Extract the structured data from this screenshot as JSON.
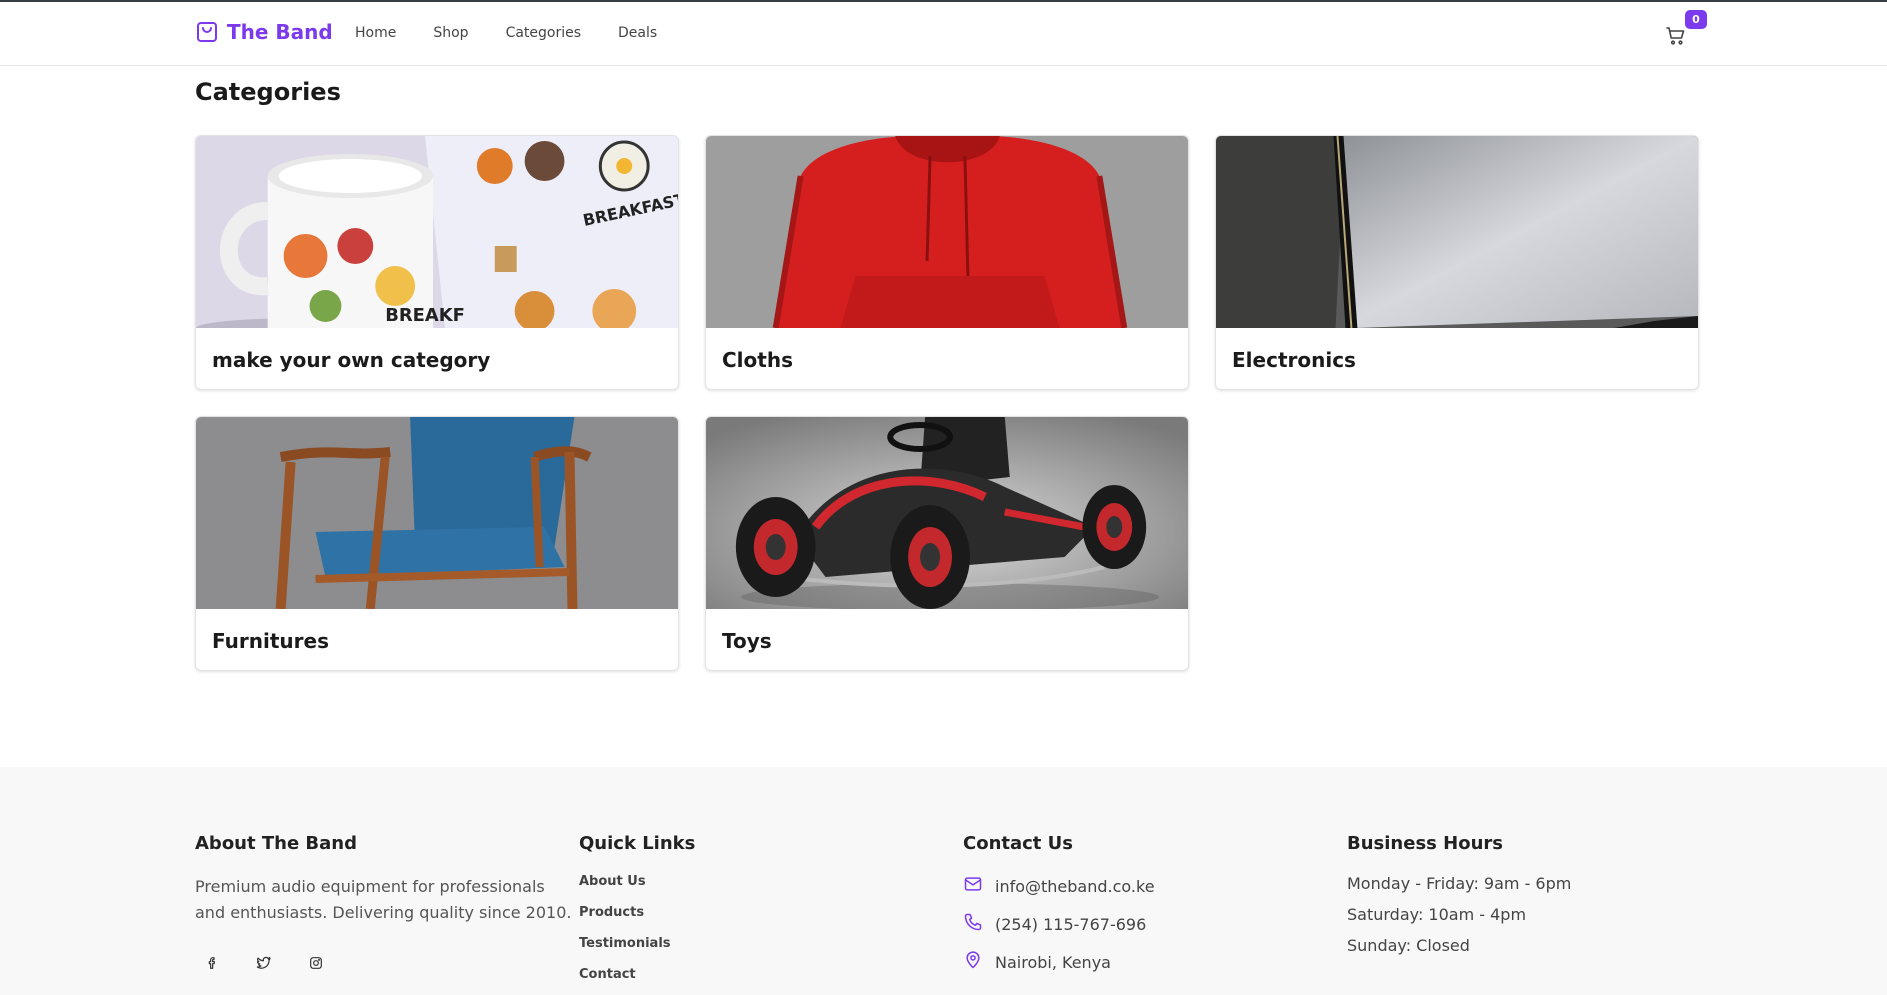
{
  "header": {
    "brand": "The Band",
    "nav": [
      "Home",
      "Shop",
      "Categories",
      "Deals"
    ],
    "cart_count": "0"
  },
  "main": {
    "title": "Categories",
    "categories": [
      {
        "name": "make your own category",
        "image": "mug-photo"
      },
      {
        "name": "Cloths",
        "image": "red-hoodie-photo"
      },
      {
        "name": "Electronics",
        "image": "monitor-photo"
      },
      {
        "name": "Furnitures",
        "image": "armchair-photo"
      },
      {
        "name": "Toys",
        "image": "go-kart-photo"
      }
    ]
  },
  "footer": {
    "about": {
      "heading": "About The Band",
      "text": "Premium audio equipment for professionals and enthusiasts. Delivering quality since 2010.",
      "socials": [
        "facebook-icon",
        "twitter-icon",
        "instagram-icon"
      ]
    },
    "quick_links": {
      "heading": "Quick Links",
      "items": [
        "About Us",
        "Products",
        "Testimonials",
        "Contact"
      ]
    },
    "contact": {
      "heading": "Contact Us",
      "email": "info@theband.co.ke",
      "phone": "(254) 115-767-696",
      "location": "Nairobi, Kenya"
    },
    "hours": {
      "heading": "Business Hours",
      "lines": [
        "Monday - Friday: 9am - 6pm",
        "Saturday: 10am - 4pm",
        "Sunday: Closed"
      ]
    }
  },
  "colors": {
    "accent": "#7c3aed",
    "footer_bg": "#f8f8f8"
  }
}
